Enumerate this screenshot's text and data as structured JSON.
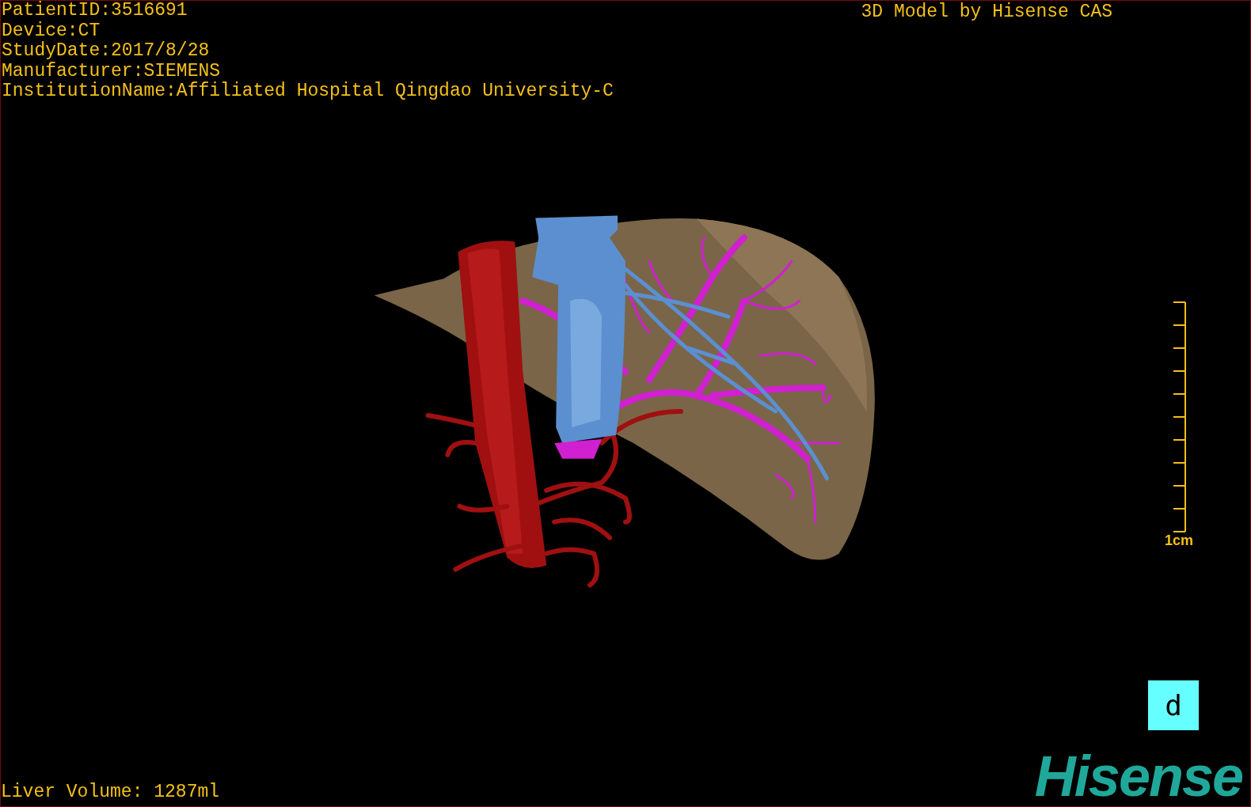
{
  "study_info": [
    "PatientID:3516691",
    "Device:CT",
    "StudyDate:2017/8/28",
    "Manufacturer:SIEMENS",
    "InstitutionName:Affiliated Hospital Qingdao University-C"
  ],
  "model_credit": "3D Model by Hisense CAS",
  "scale_bar": {
    "label": "1cm"
  },
  "view_button": {
    "label": "d"
  },
  "liver_volume": "Liver Volume: 1287ml",
  "logo": "Hisense"
}
